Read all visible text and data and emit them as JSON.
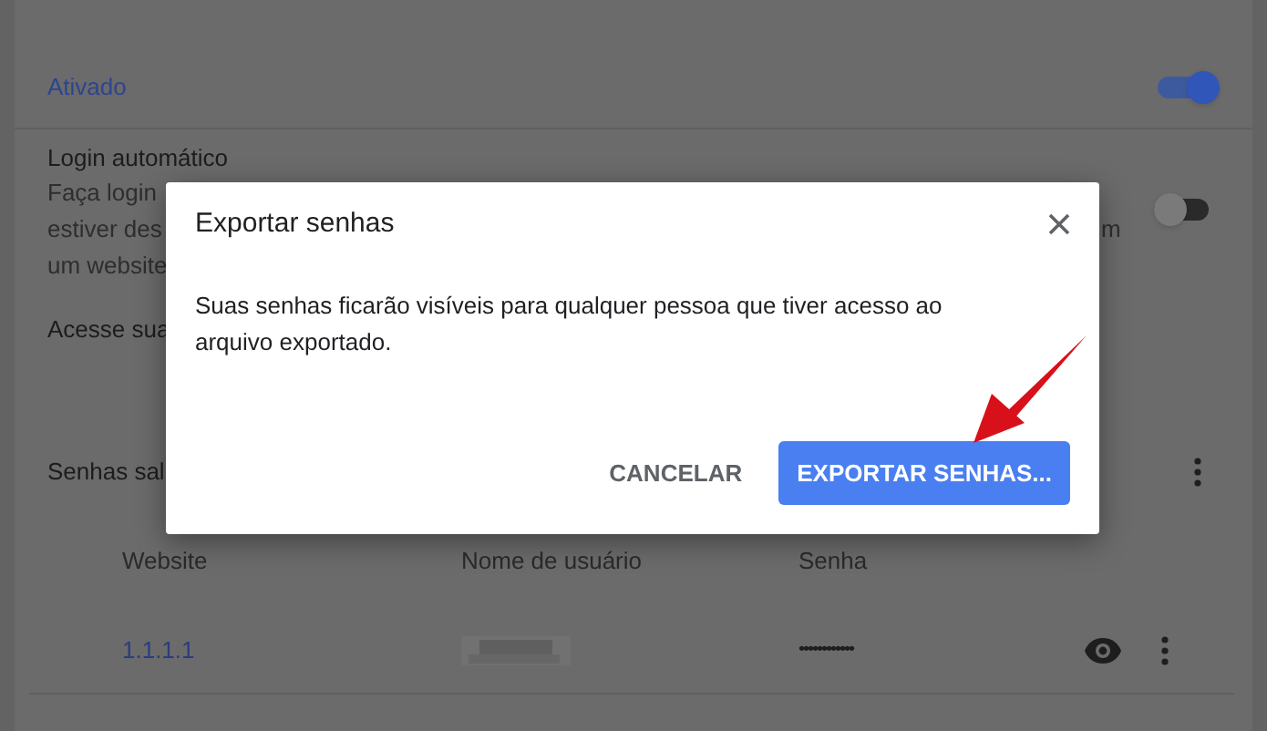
{
  "settings": {
    "enabled_label": "Ativado",
    "enabled_on": true,
    "auto_login": {
      "title": "Login automático",
      "lines": [
        "Faça login",
        "estiver des",
        "um website"
      ],
      "line_2_tail": "m",
      "on": false
    },
    "access_text": "Acesse sua",
    "saved_heading": "Senhas sal",
    "table": {
      "columns": [
        "Website",
        "Nome de usuário",
        "Senha"
      ],
      "rows": [
        {
          "website": "1.1.1.1",
          "password": "••••••••••••"
        }
      ]
    }
  },
  "dialog": {
    "title": "Exportar senhas",
    "message": "Suas senhas ficarão visíveis para qualquer pessoa que tiver acesso ao arquivo exportado.",
    "buttons": [
      {
        "kind": "text",
        "label": "CANCELAR"
      },
      {
        "kind": "primary",
        "label": "EXPORTAR SENHAS..."
      }
    ]
  }
}
